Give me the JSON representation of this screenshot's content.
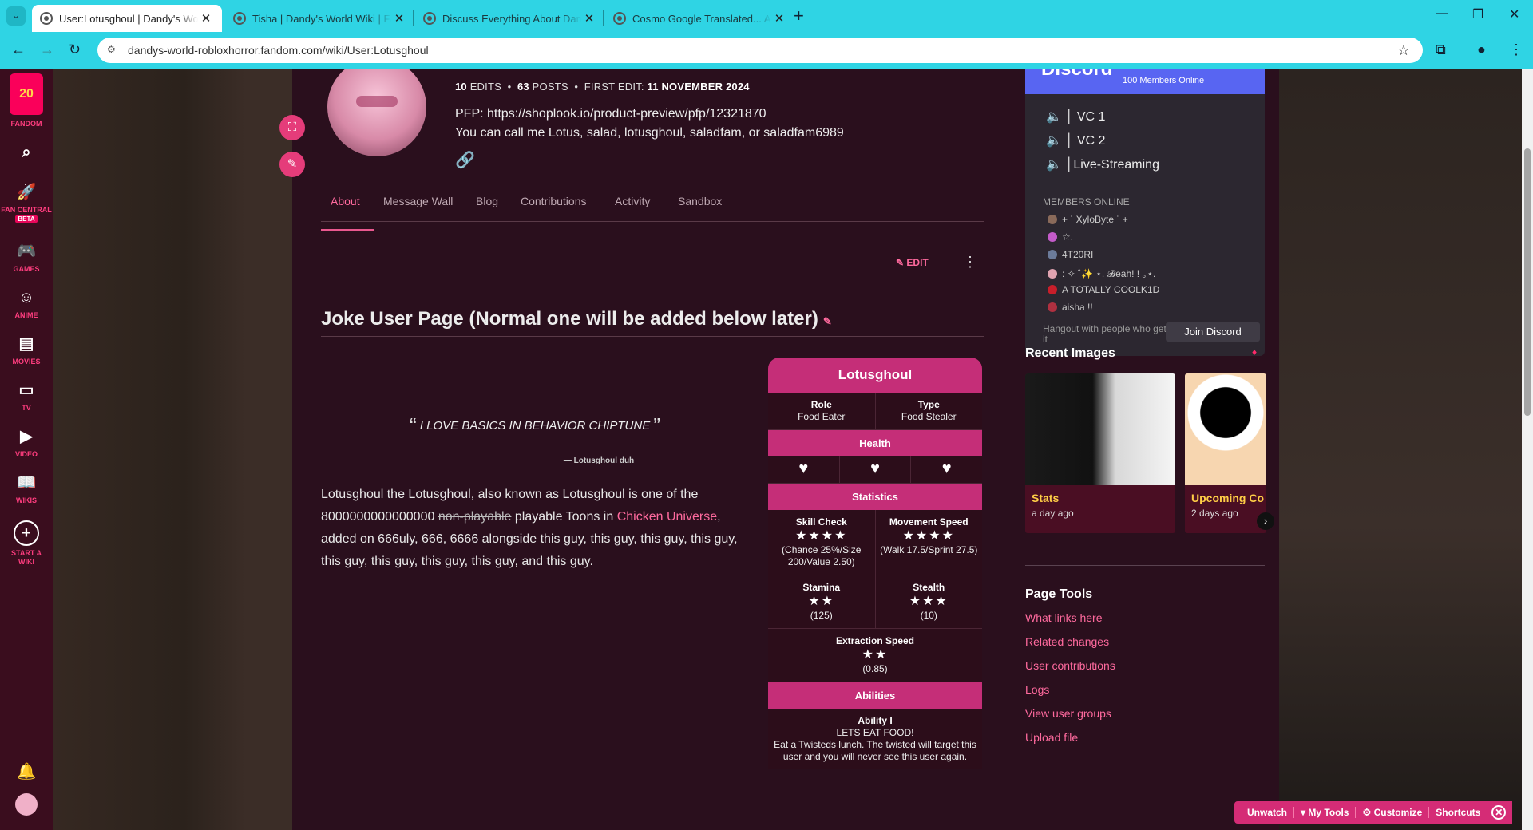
{
  "browser": {
    "tabs": [
      {
        "title": "User:Lotusghoul | Dandy's World",
        "active": true
      },
      {
        "title": "Tisha | Dandy's World Wiki | Fan",
        "active": false
      },
      {
        "title": "Discuss Everything About Dand",
        "active": false
      },
      {
        "title": "Cosmo Google Translated... Ag",
        "active": false
      }
    ],
    "url": "dandys-world-robloxhorror.fandom.com/wiki/User:Lotusghoul"
  },
  "sidebar": {
    "logo_badge": "20",
    "items": [
      {
        "label": "FANDOM",
        "icon": "fandom-logo-icon"
      },
      {
        "label": "",
        "icon": "search-icon"
      },
      {
        "label": "FAN CENTRAL",
        "badge": "BETA",
        "icon": "rocket-icon"
      },
      {
        "label": "GAMES",
        "icon": "gamepad-icon"
      },
      {
        "label": "ANIME",
        "icon": "anime-icon"
      },
      {
        "label": "MOVIES",
        "icon": "movies-icon"
      },
      {
        "label": "TV",
        "icon": "tv-icon"
      },
      {
        "label": "VIDEO",
        "icon": "video-icon"
      },
      {
        "label": "WIKIS",
        "icon": "wikis-icon"
      },
      {
        "label": "START A WIKI",
        "icon": "plus-circle-icon"
      }
    ]
  },
  "profile": {
    "edits_count": "10",
    "edits_label": "EDITS",
    "posts_count": "63",
    "posts_label": "POSTS",
    "first_edit_label": "FIRST EDIT:",
    "first_edit_date": "11 NOVEMBER 2024",
    "pfp_line": "PFP: https://shoplook.io/product-preview/pfp/12321870",
    "call_me": "You can call me Lotus, salad, lotusghoul, saladfam, or saladfam6989"
  },
  "page_tabs": [
    "About",
    "Message Wall",
    "Blog",
    "Contributions",
    "Activity",
    "Sandbox"
  ],
  "edit_label": "EDIT",
  "article": {
    "heading": "Joke User Page (Normal one will be added below later)",
    "quote": "I LOVE BASICS IN BEHAVIOR CHIPTUNE",
    "quote_source": "— Lotusghoul duh",
    "bio_1": "Lotusghoul the Lotusghoul, also known as Lotusghoul is one of the 8000000000000000 ",
    "bio_strike": "non-playable",
    "bio_2": " playable Toons in ",
    "bio_link": "Chicken Universe",
    "bio_3": ", added on 666uly, 666, 6666 alongside this guy, this guy, this guy, this guy, this guy, this guy, this guy, this guy, and this guy."
  },
  "infobox": {
    "title": "Lotusghoul",
    "role_label": "Role",
    "role_value": "Food Eater",
    "type_label": "Type",
    "type_value": "Food Stealer",
    "health_label": "Health",
    "statistics_label": "Statistics",
    "skill_check_label": "Skill Check",
    "skill_check_stars": "★★★★",
    "skill_check_detail": "(Chance 25%/Size 200/Value 2.50)",
    "movement_label": "Movement Speed",
    "movement_stars": "★★★★",
    "movement_detail": "(Walk 17.5/Sprint 27.5)",
    "stamina_label": "Stamina",
    "stamina_stars": "★★",
    "stamina_detail": "(125)",
    "stealth_label": "Stealth",
    "stealth_stars": "★★★",
    "stealth_detail": "(10)",
    "extraction_label": "Extraction Speed",
    "extraction_stars": "★★",
    "extraction_detail": "(0.85)",
    "abilities_label": "Abilities",
    "ability_name": "Ability I",
    "ability_title": "LETS EAT FOOD!",
    "ability_desc": "Eat a Twisteds lunch. The twisted will target this user and you will never see this user again."
  },
  "discord": {
    "title": "Discord",
    "members_online_count": "100 Members Online",
    "channels": [
      "VC 1",
      "VC 2",
      "Live-Streaming"
    ],
    "members_online_label": "MEMBERS ONLINE",
    "members": [
      "+ ˙ XyloByte ˙ +",
      "☆.",
      "4T20RI",
      ": ✧ ˚✨ ⋆. 𝓑eah! ! ｡⋆.",
      "A TOTALLY COOLK1D",
      "aisha !!"
    ],
    "hangout": "Hangout with people who get it",
    "join_label": "Join Discord"
  },
  "recent_images": {
    "title": "Recent Images",
    "items": [
      {
        "caption": "Stats",
        "ago": "a day ago"
      },
      {
        "caption": "Upcoming Co",
        "ago": "2 days ago"
      }
    ]
  },
  "page_tools": {
    "title": "Page Tools",
    "links": [
      "What links here",
      "Related changes",
      "User contributions",
      "Logs",
      "View user groups",
      "Upload file"
    ]
  },
  "toolbar": {
    "unwatch": "Unwatch",
    "my_tools": "▾ My Tools",
    "customize": "⚙ Customize",
    "shortcuts": "Shortcuts"
  }
}
